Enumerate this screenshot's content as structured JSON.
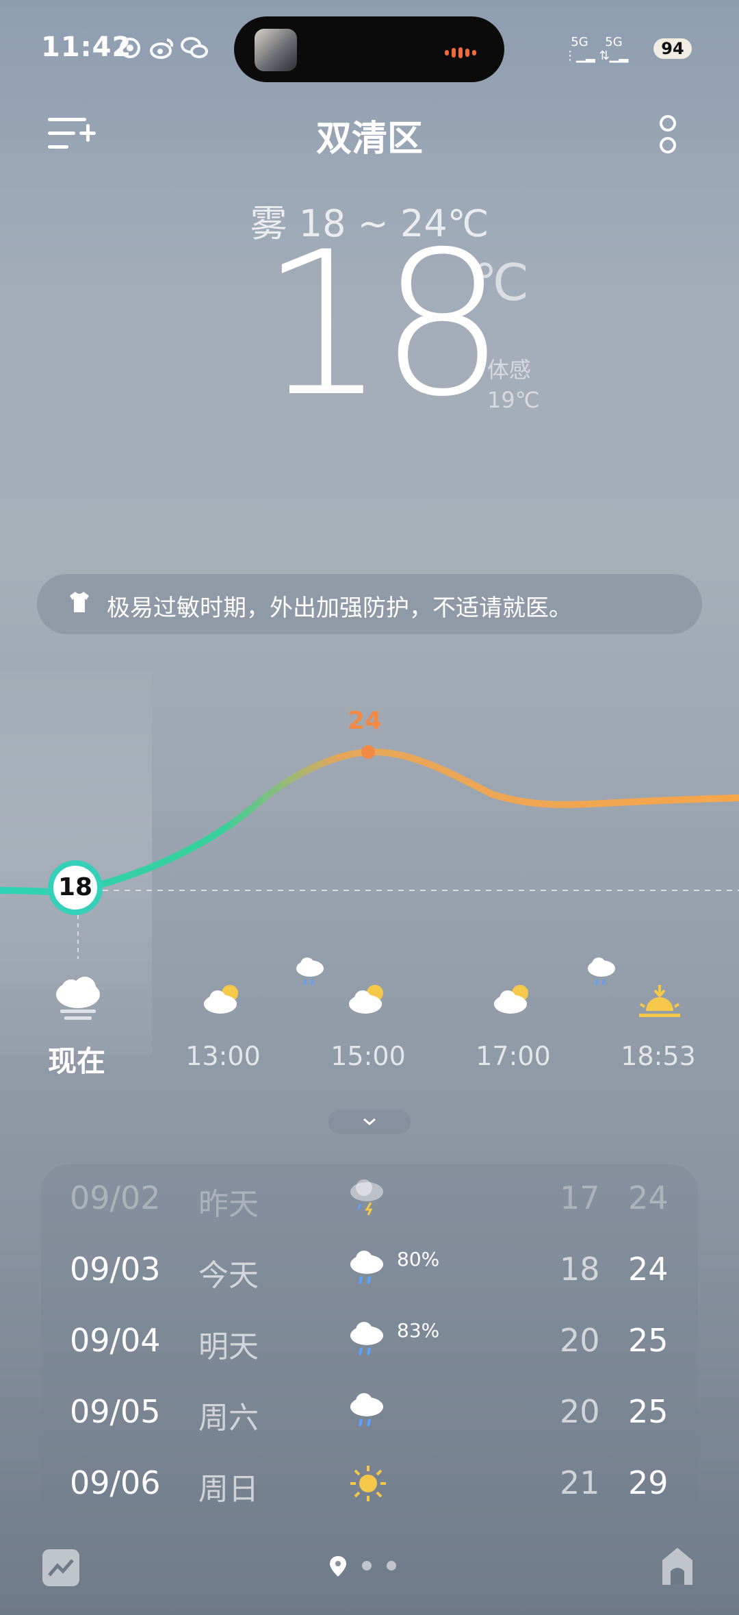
{
  "status_bar": {
    "time": "11:42",
    "notification_icons": [
      "app-icon",
      "weibo-icon",
      "wechat-icon"
    ],
    "signal1": "5G",
    "signal2": "5G",
    "battery": "94"
  },
  "header": {
    "title": "双清区"
  },
  "current": {
    "summary": "雾  18 ~ 24℃",
    "temperature": "18",
    "unit": "℃",
    "feels_label": "体感",
    "feels_value": "19℃"
  },
  "tip": {
    "text": "极易过敏时期，外出加强防护，不适请就医。"
  },
  "hourly": {
    "now_temp": "18",
    "peak_temp": "24",
    "labels": [
      "现在",
      "13:00",
      "15:00",
      "17:00",
      "18:53"
    ],
    "colors": {
      "start": "#2fd1b5",
      "end": "#f7a64a",
      "peak": "#f28a45"
    }
  },
  "forecast": [
    {
      "date": "09/02",
      "day": "昨天",
      "icon": "thunder-rain-icon",
      "pct": "",
      "lo": "17",
      "hi": "24"
    },
    {
      "date": "09/03",
      "day": "今天",
      "icon": "rain-icon",
      "pct": "80%",
      "lo": "18",
      "hi": "24"
    },
    {
      "date": "09/04",
      "day": "明天",
      "icon": "rain-icon",
      "pct": "83%",
      "lo": "20",
      "hi": "25"
    },
    {
      "date": "09/05",
      "day": "周六",
      "icon": "rain-icon",
      "pct": "",
      "lo": "20",
      "hi": "25"
    },
    {
      "date": "09/06",
      "day": "周日",
      "icon": "sunny-icon",
      "pct": "",
      "lo": "21",
      "hi": "29"
    }
  ]
}
